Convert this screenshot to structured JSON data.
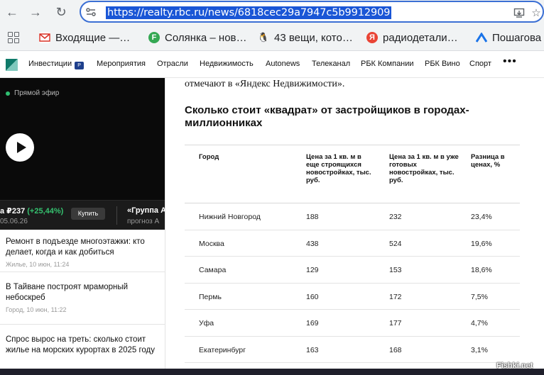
{
  "browser": {
    "url": "https://realty.rbc.ru/news/6818cec29a7947c5b9912909"
  },
  "bookmarks": [
    {
      "label": "Входящие —…",
      "icon": "gmail-icon",
      "color": "#d93025"
    },
    {
      "label": "Солянка – нов…",
      "icon": "fishki-icon",
      "color": "#34a853"
    },
    {
      "label": "43 вещи, кото…",
      "icon": "penguin-icon",
      "color": "#202124"
    },
    {
      "label": "радиодетали…",
      "icon": "yandex-icon",
      "color": "#e94435"
    },
    {
      "label": "Пошагова",
      "icon": "arrow-logo-icon",
      "color": "#1a73e8"
    }
  ],
  "site_nav": {
    "items": [
      "Инвестиции",
      "Мероприятия",
      "Отрасли",
      "Недвижимость",
      "Autonews",
      "Телеканал",
      "РБК Компании",
      "РБК Вино",
      "Спорт"
    ],
    "more": "•••"
  },
  "video": {
    "live_label": "Прямой эфир"
  },
  "ticker": {
    "name": "а ₽237",
    "change": "(+25,44%)",
    "date": "05.06.26",
    "buy_label": "Купить",
    "second_name": "«Группа А",
    "second_sub": "прогноз А"
  },
  "news": [
    {
      "title": "Ремонт в подъезде многоэтажки: кто делает, когда и как добиться",
      "meta": "Жилье, 10 июн, 11:24"
    },
    {
      "title": "В Тайване построят мраморный небоскреб",
      "meta": "Город, 10 июн, 11:22"
    },
    {
      "title": "Спрос вырос на треть: сколько стоит жилье на морских курортах в 2025 году",
      "meta": ""
    }
  ],
  "article": {
    "prev_text": "отмечают в «Яндекс Недвижимости».",
    "heading": "Сколько стоит «квадрат» от застройщиков в городах-миллионниках",
    "table": {
      "headers": [
        "Город",
        "Цена за 1 кв. м в еще строящихся новостройках, тыс. руб.",
        "Цена за 1 кв. м в уже готовых новостройках, тыс. руб.",
        "Разница в ценах, %"
      ],
      "rows": [
        [
          "Нижний Новгород",
          "188",
          "232",
          "23,4%"
        ],
        [
          "Москва",
          "438",
          "524",
          "19,6%"
        ],
        [
          "Самара",
          "129",
          "153",
          "18,6%"
        ],
        [
          "Пермь",
          "160",
          "172",
          "7,5%"
        ],
        [
          "Уфа",
          "169",
          "177",
          "4,7%"
        ],
        [
          "Екатеринбург",
          "163",
          "168",
          "3,1%"
        ]
      ]
    }
  },
  "watermark": "Fishki.net"
}
